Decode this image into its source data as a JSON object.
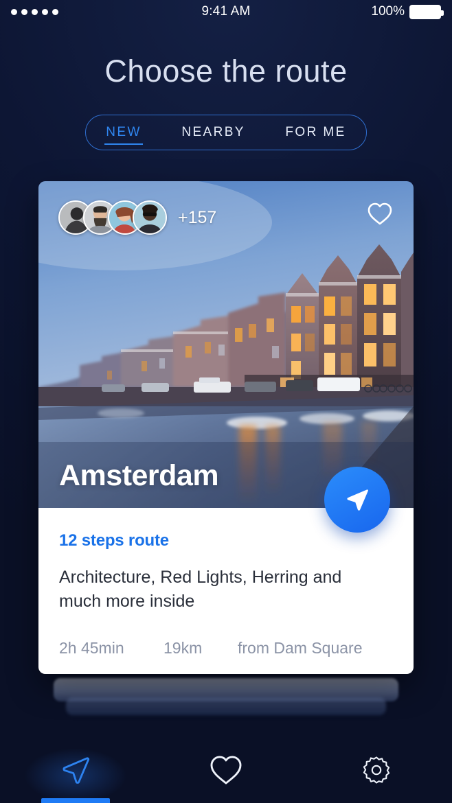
{
  "statusbar": {
    "signal_icon": "signal-dots",
    "time": "9:41 AM",
    "battery_percent": "100%",
    "battery_icon": "battery-full-icon"
  },
  "header": {
    "title": "Choose the route"
  },
  "tabs": {
    "items": [
      {
        "label": "NEW",
        "active": true
      },
      {
        "label": "NEARBY",
        "active": false
      },
      {
        "label": "FOR ME",
        "active": false
      }
    ]
  },
  "card": {
    "city": "Amsterdam",
    "photo_alt": "amsterdam-canal-photo",
    "avatars": {
      "count_label": "+157",
      "faces": 4
    },
    "favorite_icon": "heart-outline-icon",
    "start_route_icon": "navigate-arrow-icon",
    "steps": "12 steps route",
    "description": "Architecture, Red Lights, Herring and much more inside",
    "meta": {
      "duration": "2h 45min",
      "distance": "19km",
      "start": "from Dam Square"
    }
  },
  "bottom_nav": {
    "items": [
      {
        "icon": "navigate-arrow-icon",
        "name": "routes",
        "active": true
      },
      {
        "icon": "heart-outline-icon",
        "name": "favorites",
        "active": false
      },
      {
        "icon": "gear-icon",
        "name": "settings",
        "active": false
      }
    ]
  },
  "colors": {
    "background": "#0c1430",
    "accent": "#1f7bf5",
    "tab_active": "#2f86f0",
    "card_surface": "#ffffff",
    "muted_text": "#8b93a6",
    "body_text": "#2a2f3a"
  }
}
